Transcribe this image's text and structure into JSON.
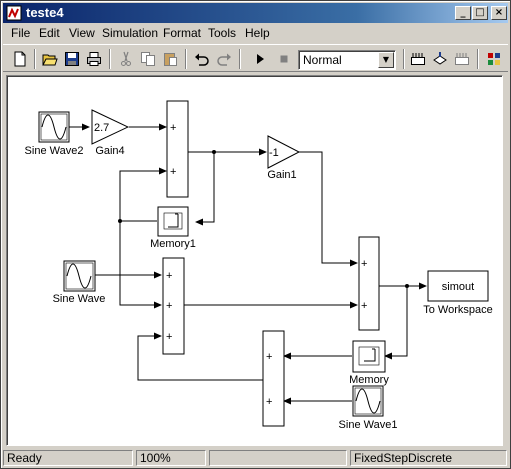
{
  "window": {
    "title": "teste4"
  },
  "menu": [
    "File",
    "Edit",
    "View",
    "Simulation",
    "Format",
    "Tools",
    "Help"
  ],
  "toolbar": {
    "sim_mode": "Normal"
  },
  "blocks": {
    "sine_wave2": "Sine Wave2",
    "gain4": "Gain4",
    "gain4_value": "2.7",
    "gain1": "Gain1",
    "gain1_value": "-1",
    "memory1": "Memory1",
    "sine_wave": "Sine Wave",
    "to_workspace": "To Workspace",
    "to_workspace_var": "simout",
    "memory": "Memory",
    "sine_wave1": "Sine Wave1",
    "plus": "+"
  },
  "status": {
    "left": "Ready",
    "zoom": "100%",
    "middle": "",
    "solver": "FixedStepDiscrete"
  }
}
